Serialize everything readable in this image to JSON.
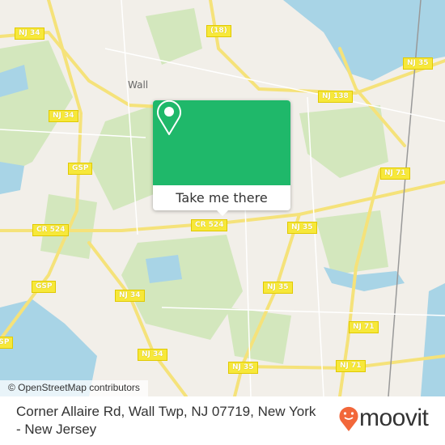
{
  "map": {
    "attribution": "© OpenStreetMap contributors",
    "places": [
      {
        "label": "Wall"
      }
    ],
    "road_labels": [
      "NJ 34",
      "(18)",
      "NJ 35",
      "NJ 138",
      "NJ 34",
      "GSP",
      "NJ 71",
      "CR 524",
      "CR 524",
      "NJ 35",
      "GSP",
      "NJ 34",
      "NJ 35",
      "NJ 71",
      "NJ 34",
      "NJ 35",
      "NJ 71",
      "GSP"
    ],
    "colors": {
      "land": "#f2efe9",
      "park": "#d3e7bd",
      "water": "#a8d4e6",
      "road": "#f5e27a"
    }
  },
  "popup": {
    "button_label": "Take me there",
    "icon": "map-pin-icon",
    "color": "#1fb86a"
  },
  "footer": {
    "address": "Corner Allaire Rd, Wall Twp, NJ 07719, New York - New Jersey",
    "brand": "moovit",
    "brand_color": "#f2673a"
  }
}
